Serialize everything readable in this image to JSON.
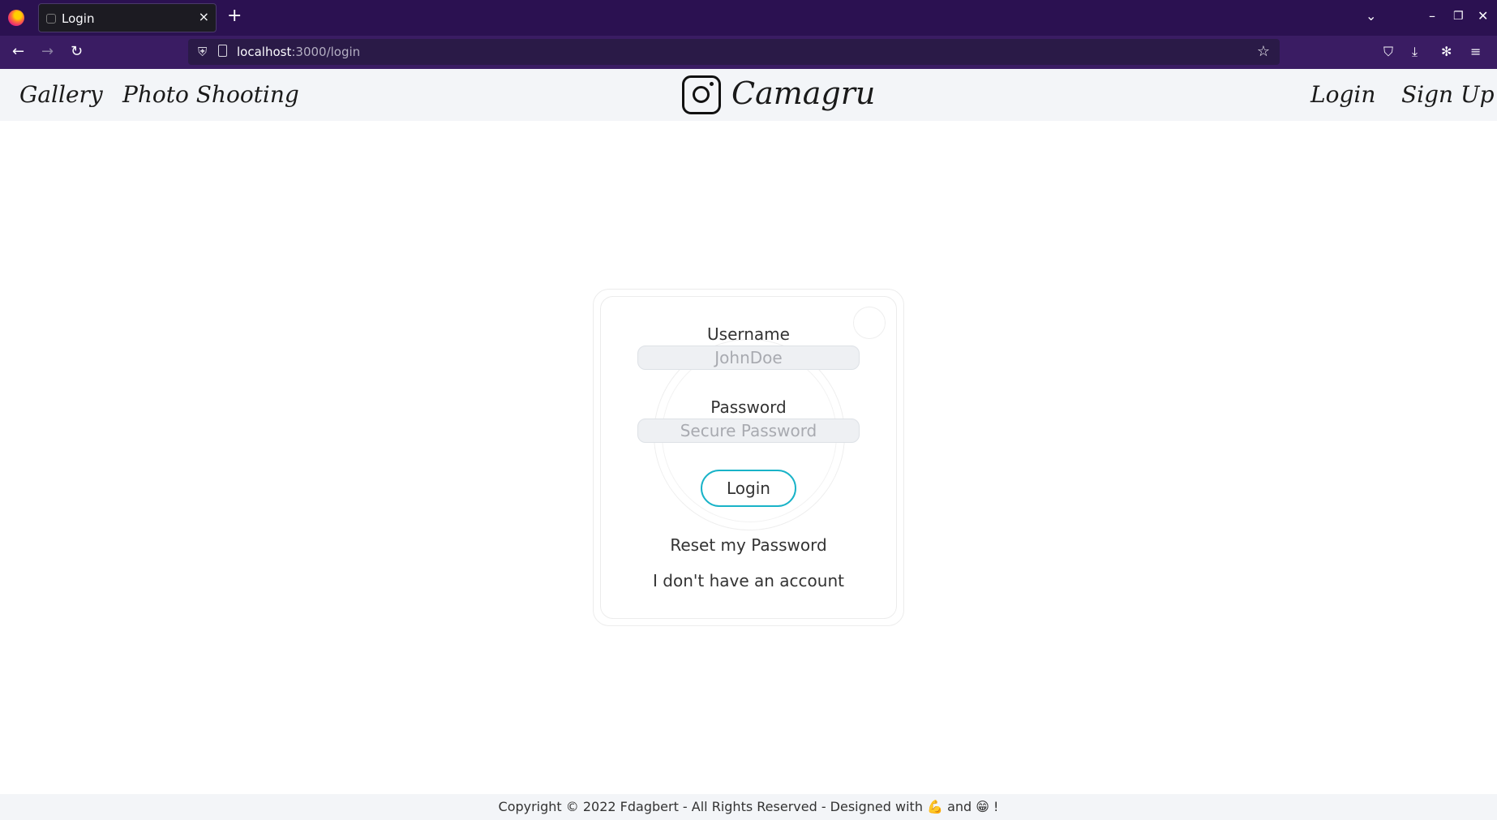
{
  "browser": {
    "tab_title": "Login",
    "tab_close": "×",
    "new_tab": "+",
    "url_host": "localhost",
    "url_path": ":3000/login",
    "icons": {
      "back": "←",
      "forward": "→",
      "reload": "↻",
      "star": "☆",
      "list_tabs": "⌄",
      "minimize": "–",
      "maximize": "❐",
      "close": "✕",
      "pocket": "⛉",
      "download": "⤓",
      "extensions": "✻",
      "menu": "≡"
    }
  },
  "header": {
    "nav_left": [
      "Gallery",
      "Photo Shooting"
    ],
    "brand": "Camagru",
    "nav_right": [
      "Login",
      "Sign Up"
    ]
  },
  "login": {
    "username_label": "Username",
    "username_placeholder": "JohnDoe",
    "password_label": "Password",
    "password_placeholder": "Secure Password",
    "submit_label": "Login",
    "reset_link": "Reset my Password",
    "signup_link": "I don't have an account"
  },
  "footer": {
    "text_before": "Copyright © 2022 Fdagbert - All Rights Reserved - Designed with",
    "emoji_1": "💪",
    "and": "and",
    "emoji_2": "😁",
    "text_after": "!"
  },
  "colors": {
    "tabbar_bg": "#2b1151",
    "navbar_bg": "#3a1c63",
    "header_bg": "#f3f5f8",
    "accent": "#19b3c8"
  }
}
